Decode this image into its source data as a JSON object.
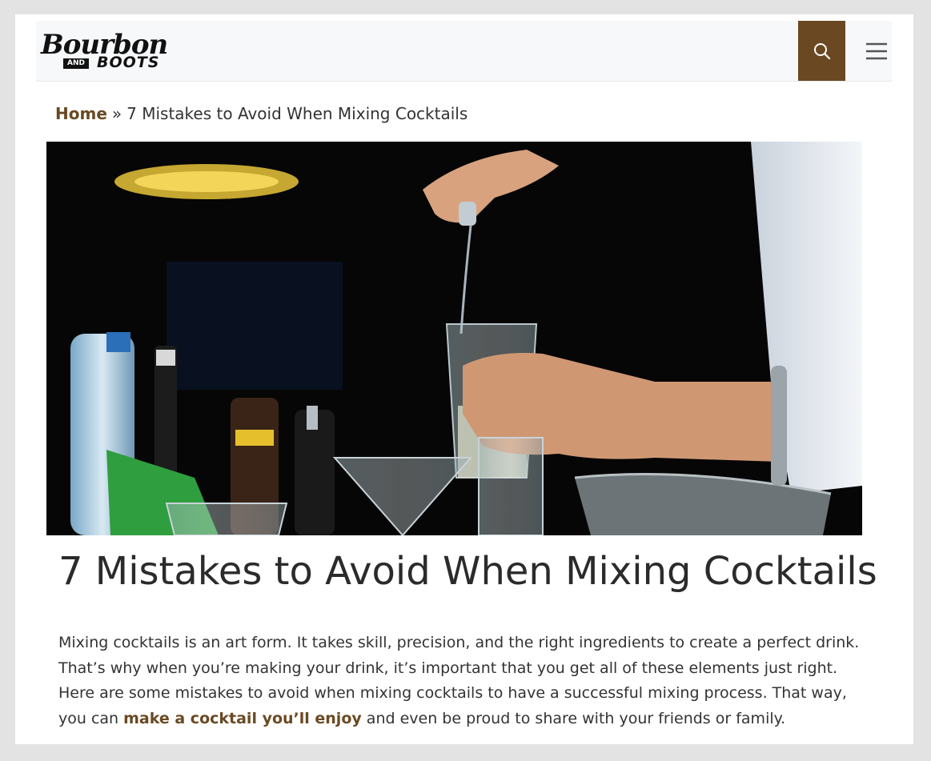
{
  "brand": {
    "logo_script": "Bourbon",
    "logo_and": "AND",
    "logo_boots": "BOOTS"
  },
  "header": {
    "search_icon": "search-icon",
    "menu_icon": "hamburger-menu-icon",
    "accent_color": "#6a4922"
  },
  "breadcrumb": {
    "home": "Home",
    "separator": "»",
    "current": "7 Mistakes to Avoid When Mixing Cocktails"
  },
  "article": {
    "title": "7 Mistakes to Avoid When Mixing Cocktails",
    "intro_before_link": "Mixing cocktails is an art form. It takes skill, precision, and the right ingredients to create a perfect drink. That’s why when you’re making your drink, it’s important that you get all of these elements just right. Here are some mistakes to avoid when mixing cocktails to have a successful mixing process. That way, you can ",
    "intro_link": "make a cocktail you’ll enjoy",
    "intro_after_link": " and even be proud to share with your friends or family."
  }
}
